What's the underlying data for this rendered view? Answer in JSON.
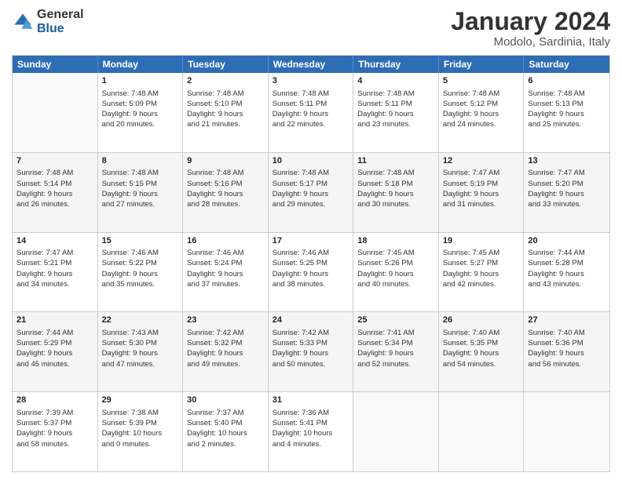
{
  "logo": {
    "general": "General",
    "blue": "Blue"
  },
  "title": "January 2024",
  "location": "Modolo, Sardinia, Italy",
  "header_days": [
    "Sunday",
    "Monday",
    "Tuesday",
    "Wednesday",
    "Thursday",
    "Friday",
    "Saturday"
  ],
  "weeks": [
    [
      {
        "day": "",
        "content": ""
      },
      {
        "day": "1",
        "content": "Sunrise: 7:48 AM\nSunset: 5:09 PM\nDaylight: 9 hours\nand 20 minutes."
      },
      {
        "day": "2",
        "content": "Sunrise: 7:48 AM\nSunset: 5:10 PM\nDaylight: 9 hours\nand 21 minutes."
      },
      {
        "day": "3",
        "content": "Sunrise: 7:48 AM\nSunset: 5:11 PM\nDaylight: 9 hours\nand 22 minutes."
      },
      {
        "day": "4",
        "content": "Sunrise: 7:48 AM\nSunset: 5:11 PM\nDaylight: 9 hours\nand 23 minutes."
      },
      {
        "day": "5",
        "content": "Sunrise: 7:48 AM\nSunset: 5:12 PM\nDaylight: 9 hours\nand 24 minutes."
      },
      {
        "day": "6",
        "content": "Sunrise: 7:48 AM\nSunset: 5:13 PM\nDaylight: 9 hours\nand 25 minutes."
      }
    ],
    [
      {
        "day": "7",
        "content": "Sunrise: 7:48 AM\nSunset: 5:14 PM\nDaylight: 9 hours\nand 26 minutes."
      },
      {
        "day": "8",
        "content": "Sunrise: 7:48 AM\nSunset: 5:15 PM\nDaylight: 9 hours\nand 27 minutes."
      },
      {
        "day": "9",
        "content": "Sunrise: 7:48 AM\nSunset: 5:16 PM\nDaylight: 9 hours\nand 28 minutes."
      },
      {
        "day": "10",
        "content": "Sunrise: 7:48 AM\nSunset: 5:17 PM\nDaylight: 9 hours\nand 29 minutes."
      },
      {
        "day": "11",
        "content": "Sunrise: 7:48 AM\nSunset: 5:18 PM\nDaylight: 9 hours\nand 30 minutes."
      },
      {
        "day": "12",
        "content": "Sunrise: 7:47 AM\nSunset: 5:19 PM\nDaylight: 9 hours\nand 31 minutes."
      },
      {
        "day": "13",
        "content": "Sunrise: 7:47 AM\nSunset: 5:20 PM\nDaylight: 9 hours\nand 33 minutes."
      }
    ],
    [
      {
        "day": "14",
        "content": "Sunrise: 7:47 AM\nSunset: 5:21 PM\nDaylight: 9 hours\nand 34 minutes."
      },
      {
        "day": "15",
        "content": "Sunrise: 7:46 AM\nSunset: 5:22 PM\nDaylight: 9 hours\nand 35 minutes."
      },
      {
        "day": "16",
        "content": "Sunrise: 7:46 AM\nSunset: 5:24 PM\nDaylight: 9 hours\nand 37 minutes."
      },
      {
        "day": "17",
        "content": "Sunrise: 7:46 AM\nSunset: 5:25 PM\nDaylight: 9 hours\nand 38 minutes."
      },
      {
        "day": "18",
        "content": "Sunrise: 7:45 AM\nSunset: 5:26 PM\nDaylight: 9 hours\nand 40 minutes."
      },
      {
        "day": "19",
        "content": "Sunrise: 7:45 AM\nSunset: 5:27 PM\nDaylight: 9 hours\nand 42 minutes."
      },
      {
        "day": "20",
        "content": "Sunrise: 7:44 AM\nSunset: 5:28 PM\nDaylight: 9 hours\nand 43 minutes."
      }
    ],
    [
      {
        "day": "21",
        "content": "Sunrise: 7:44 AM\nSunset: 5:29 PM\nDaylight: 9 hours\nand 45 minutes."
      },
      {
        "day": "22",
        "content": "Sunrise: 7:43 AM\nSunset: 5:30 PM\nDaylight: 9 hours\nand 47 minutes."
      },
      {
        "day": "23",
        "content": "Sunrise: 7:42 AM\nSunset: 5:32 PM\nDaylight: 9 hours\nand 49 minutes."
      },
      {
        "day": "24",
        "content": "Sunrise: 7:42 AM\nSunset: 5:33 PM\nDaylight: 9 hours\nand 50 minutes."
      },
      {
        "day": "25",
        "content": "Sunrise: 7:41 AM\nSunset: 5:34 PM\nDaylight: 9 hours\nand 52 minutes."
      },
      {
        "day": "26",
        "content": "Sunrise: 7:40 AM\nSunset: 5:35 PM\nDaylight: 9 hours\nand 54 minutes."
      },
      {
        "day": "27",
        "content": "Sunrise: 7:40 AM\nSunset: 5:36 PM\nDaylight: 9 hours\nand 56 minutes."
      }
    ],
    [
      {
        "day": "28",
        "content": "Sunrise: 7:39 AM\nSunset: 5:37 PM\nDaylight: 9 hours\nand 58 minutes."
      },
      {
        "day": "29",
        "content": "Sunrise: 7:38 AM\nSunset: 5:39 PM\nDaylight: 10 hours\nand 0 minutes."
      },
      {
        "day": "30",
        "content": "Sunrise: 7:37 AM\nSunset: 5:40 PM\nDaylight: 10 hours\nand 2 minutes."
      },
      {
        "day": "31",
        "content": "Sunrise: 7:36 AM\nSunset: 5:41 PM\nDaylight: 10 hours\nand 4 minutes."
      },
      {
        "day": "",
        "content": ""
      },
      {
        "day": "",
        "content": ""
      },
      {
        "day": "",
        "content": ""
      }
    ]
  ]
}
